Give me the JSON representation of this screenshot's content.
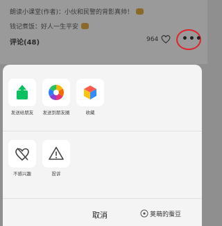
{
  "comments": [
    {
      "text": "朗读小课堂(作者)：小伙和民警的背影真帅！"
    },
    {
      "text": "钱记煮饭：好人一生平安"
    }
  ],
  "comments_header": "评论(48)",
  "like_count": "964",
  "share_sheet": {
    "row1": [
      {
        "icon": "share-to-friend-icon",
        "label": "发送给朋友"
      },
      {
        "icon": "moments-icon",
        "label": "发送到朋友圈"
      },
      {
        "icon": "favorite-cube-icon",
        "label": "收藏"
      }
    ],
    "row2": [
      {
        "icon": "not-interested-icon",
        "label": "不感兴趣"
      },
      {
        "icon": "report-icon",
        "label": "投诉"
      }
    ],
    "cancel": "取消"
  },
  "watermark": "荚萌的蚕豆",
  "colors": {
    "highlight": "#e0242c",
    "share_green": "#07c160"
  }
}
